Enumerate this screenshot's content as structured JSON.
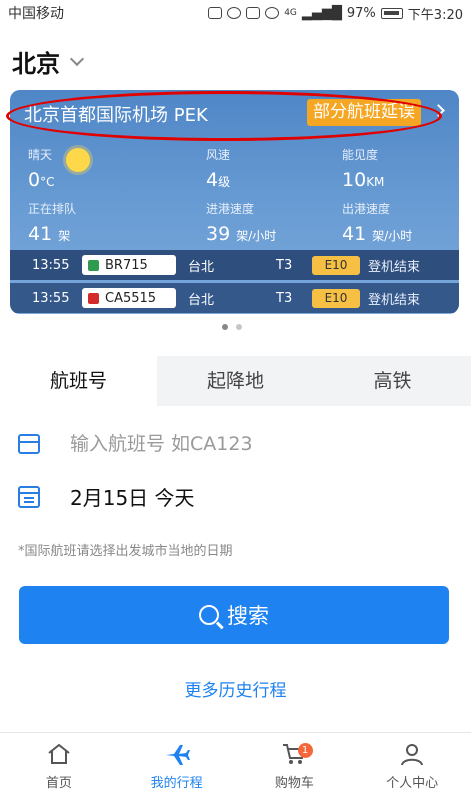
{
  "status_bar": {
    "carrier": "中国移动",
    "network": "4G",
    "battery": "97%",
    "time": "下午3:20"
  },
  "header": {
    "city": "北京"
  },
  "airport_card": {
    "airport_name": "北京首都国际机场 PEK",
    "delay_label": "部分航班延误",
    "weather": {
      "label": "晴天",
      "value": "0",
      "unit": "°C",
      "icon": "sun-icon"
    },
    "wind": {
      "label": "风速",
      "value": "4",
      "unit": "级"
    },
    "visibility": {
      "label": "能见度",
      "value": "10",
      "unit": "KM"
    },
    "queue": {
      "label": "正在排队",
      "value": "41",
      "unit": "架"
    },
    "arrival_rate": {
      "label": "进港速度",
      "value": "39",
      "unit": "架/小时"
    },
    "departure_rate": {
      "label": "出港速度",
      "value": "41",
      "unit": "架/小时"
    },
    "flights": [
      {
        "time": "13:55",
        "code": "BR715",
        "dest": "台北",
        "terminal": "T3",
        "gate": "E10",
        "status": "登机结束",
        "logo_color": "#2e9b4e"
      },
      {
        "time": "13:55",
        "code": "CA5515",
        "dest": "台北",
        "terminal": "T3",
        "gate": "E10",
        "status": "登机结束",
        "logo_color": "#d42a2a"
      }
    ]
  },
  "tabs": [
    {
      "label": "航班号",
      "active": true
    },
    {
      "label": "起降地",
      "active": false
    },
    {
      "label": "高铁",
      "active": false
    }
  ],
  "form": {
    "flight_placeholder": "输入航班号 如CA123",
    "date": "2月15日 今天",
    "note": "*国际航班请选择出发城市当地的日期",
    "search_label": "搜索",
    "history_label": "更多历史行程"
  },
  "bottom_nav": [
    {
      "label": "首页",
      "icon": "home-icon"
    },
    {
      "label": "我的行程",
      "icon": "plane-icon",
      "active": true
    },
    {
      "label": "购物车",
      "icon": "cart-icon",
      "badge": "1"
    },
    {
      "label": "个人中心",
      "icon": "user-icon"
    }
  ],
  "colors": {
    "accent": "#1e82f0",
    "delay_badge": "#f5a623",
    "gate_badge": "#f5c043",
    "annotation": "#e00000"
  }
}
